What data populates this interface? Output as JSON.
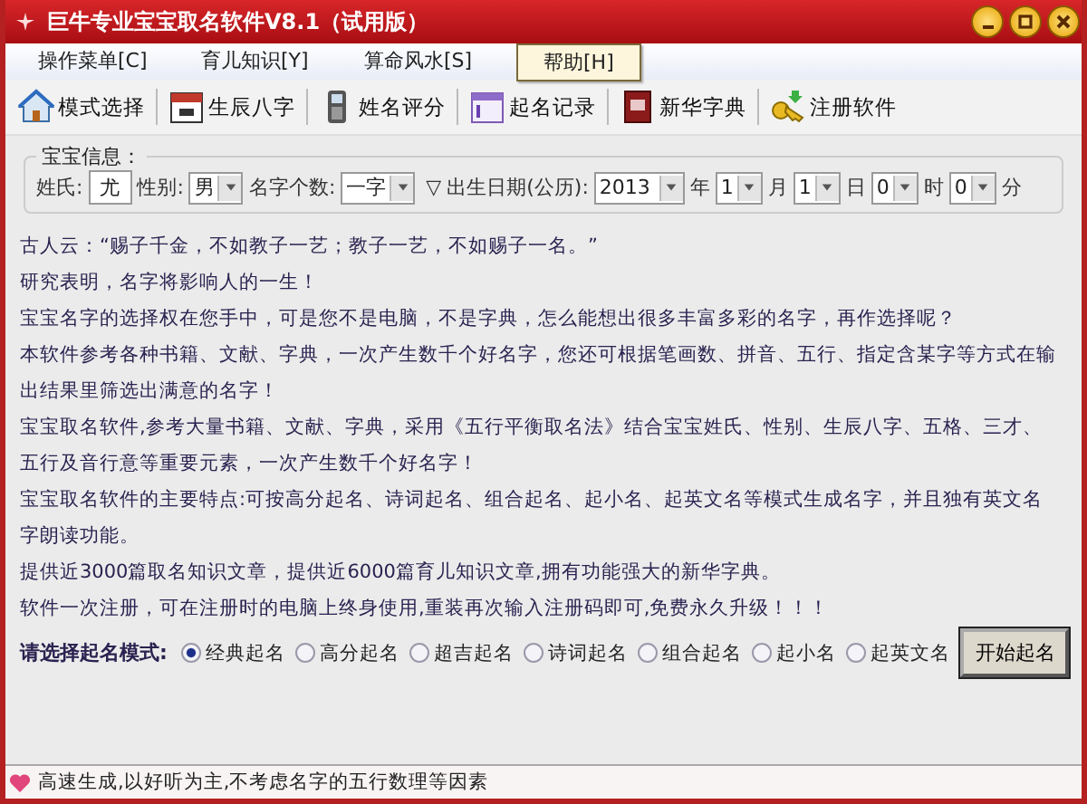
{
  "window": {
    "title": "巨牛专业宝宝取名软件V8.1（试用版）"
  },
  "menu": [
    {
      "label": "操作菜单[C]",
      "selected": false
    },
    {
      "label": "育儿知识[Y]",
      "selected": false
    },
    {
      "label": "算命风水[S]",
      "selected": false
    },
    {
      "label": "帮助[H]",
      "selected": true
    }
  ],
  "toolbar": [
    {
      "label": "模式选择",
      "kind": "house"
    },
    {
      "label": "生辰八字",
      "kind": "calendar"
    },
    {
      "label": "姓名评分",
      "kind": "phone"
    },
    {
      "label": "起名记录",
      "kind": "planner"
    },
    {
      "label": "新华字典",
      "kind": "book"
    },
    {
      "label": "注册软件",
      "kind": "key"
    }
  ],
  "info": {
    "title": "宝宝信息：",
    "surname_label": "姓氏:",
    "surname": "尤",
    "gender_label": "性别:",
    "gender": "男",
    "count_label": "名字个数:",
    "count": "一字",
    "triangle": "▽",
    "birth_label": "出生日期(公历):",
    "date": [
      {
        "value": "2013",
        "unit": "年"
      },
      {
        "value": "1",
        "unit": "月"
      },
      {
        "value": "1",
        "unit": "日"
      },
      {
        "value": "0",
        "unit": "时"
      },
      {
        "value": "0",
        "unit": "分"
      }
    ]
  },
  "intro": [
    "古人云：“赐子千金，不如教子一艺；教子一艺，不如赐子一名。”",
    "研究表明，名字将影响人的一生！",
    "宝宝名字的选择权在您手中，可是您不是电脑，不是字典，怎么能想出很多丰富多彩的名字，再作选择呢？",
    "本软件参考各种书籍、文献、字典，一次产生数千个好名字，您还可根据笔画数、拼音、五行、指定含某字等方式在输出结果里筛选出满意的名字！",
    "宝宝取名软件,参考大量书籍、文献、字典，采用《五行平衡取名法》结合宝宝姓氏、性别、生辰八字、五格、三才、五行及音行意等重要元素，一次产生数千个好名字！",
    "宝宝取名软件的主要特点:可按高分起名、诗词起名、组合起名、起小名、起英文名等模式生成名字，并且独有英文名字朗读功能。",
    "提供近3000篇取名知识文章，提供近6000篇育儿知识文章,拥有功能强大的新华字典。",
    "软件一次注册，可在注册时的电脑上终身使用,重装再次输入注册码即可,免费永久升级！！！"
  ],
  "mode": {
    "label": "请选择起名模式:",
    "options": [
      {
        "label": "经典起名",
        "selected": true
      },
      {
        "label": "高分起名",
        "selected": false
      },
      {
        "label": "超吉起名",
        "selected": false
      },
      {
        "label": "诗词起名",
        "selected": false
      },
      {
        "label": "组合起名",
        "selected": false
      },
      {
        "label": "起小名",
        "selected": false
      },
      {
        "label": "起英文名",
        "selected": false
      }
    ],
    "button": "开始起名"
  },
  "status_bar": {
    "text": "高速生成,以好听为主,不考虑名字的五行数理等因素"
  }
}
